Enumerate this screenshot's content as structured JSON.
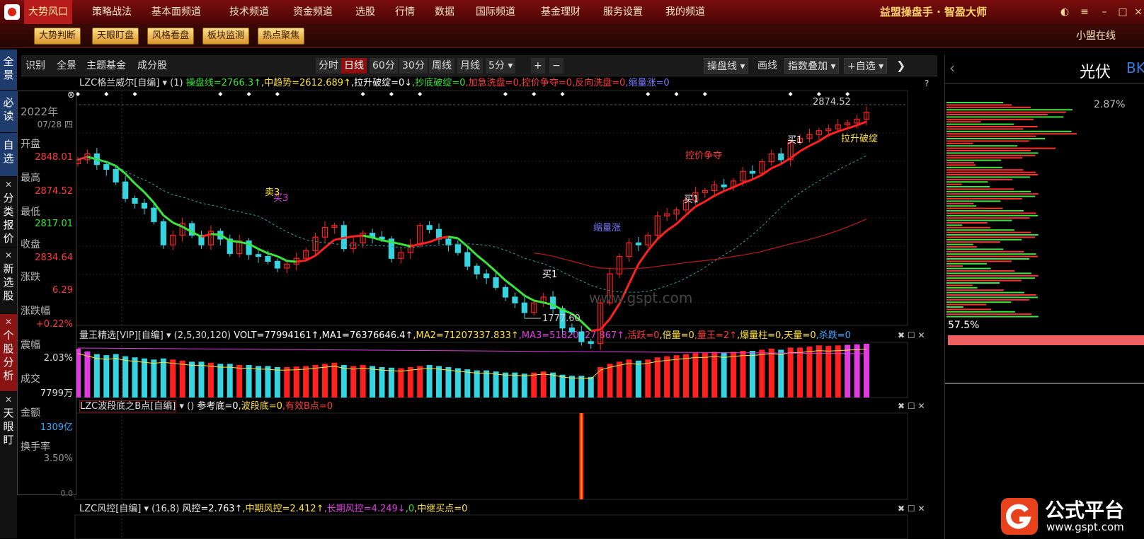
{
  "topmenu": {
    "items": [
      "大势风口",
      "策略战法",
      "基本面频道",
      "技术频道",
      "资金频道",
      "选股",
      "行情",
      "数据",
      "国际频道",
      "基金理财",
      "服务设置",
      "我的频道"
    ],
    "brand": "益盟操盘手 · 智盈大师"
  },
  "subbar": {
    "buttons": [
      "大势判断",
      "天眼盯盘",
      "风格看盘",
      "板块监测",
      "热点聚焦"
    ],
    "online": "小盟在线"
  },
  "lefttabs": [
    "全景",
    "必读",
    "自选",
    "分类报价",
    "新选股",
    "个股分析",
    "天眼盯"
  ],
  "info": {
    "year": "2022年",
    "date": "07/28 四",
    "open_label": "开盘",
    "open": "2848.01",
    "high_label": "最高",
    "high": "2874.52",
    "low_label": "最低",
    "low": "2817.01",
    "close_label": "收盘",
    "close": "2834.64",
    "change_label": "涨跌",
    "change": "6.29",
    "pct_label": "涨跌幅",
    "pct": "+0.22%",
    "amp_label": "震幅",
    "amp": "2.03%",
    "vol_label": "成交",
    "vol": "7799万",
    "amt_label": "金额",
    "amt": "1309亿",
    "turn_label": "换手率",
    "turn": "3.50%",
    "zero": "0.0"
  },
  "toolbar": {
    "left": [
      "识别",
      "全景",
      "主题基金",
      "成分股"
    ],
    "periods": [
      "分时",
      "日线",
      "60分",
      "30分",
      "周线",
      "月线",
      "5分"
    ],
    "active_period": "日线",
    "plus": "+",
    "minus": "−",
    "right": [
      "操盘线",
      "画线",
      "指数叠加",
      "+自选"
    ]
  },
  "main_panel": {
    "name": "LZC格兰威尔[自编]",
    "param": "(1)",
    "items": [
      {
        "t": "操盘线=2766.3↑",
        "c": "#35e635"
      },
      {
        "t": "中趋势=2612.689↑",
        "c": "#ffe23a"
      },
      {
        "t": "拉升破绽=0↓",
        "c": "#ffffff"
      },
      {
        "t": "抄底破绽=0",
        "c": "#35e635"
      },
      {
        "t": "加急洗盘=0",
        "c": "#ff3b3b"
      },
      {
        "t": "控价争夺=0",
        "c": "#ff3b3b"
      },
      {
        "t": "反向洗盘=0",
        "c": "#ff3b3b"
      },
      {
        "t": "缩量涨=0",
        "c": "#7b7bff"
      }
    ],
    "high_label": "2874.52",
    "low_label": "1777.60",
    "right_pct": "2.87%",
    "annotations": [
      {
        "t": "买3",
        "c": "#d63bd6"
      },
      {
        "t": "卖3",
        "c": "#ffe23a"
      },
      {
        "t": "买1",
        "c": "#ffffff"
      },
      {
        "t": "控价争夺",
        "c": "#ff3b3b"
      },
      {
        "t": "买1",
        "c": "#ffffff"
      },
      {
        "t": "买1",
        "c": "#ffffff"
      },
      {
        "t": "拉升破绽",
        "c": "#ffe23a"
      },
      {
        "t": "缩量涨",
        "c": "#7b7bff"
      }
    ],
    "watermark": "www.gspt.com"
  },
  "vol_panel": {
    "name": "量王精选[VIP][自编]",
    "param": "(2,5,30,120)",
    "items": [
      {
        "t": "VOLT=77994161↑",
        "c": "#ffffff"
      },
      {
        "t": "MA1=76376646.4↑",
        "c": "#ffffff"
      },
      {
        "t": "MA2=71207337.833↑",
        "c": "#ffe23a"
      },
      {
        "t": "MA3=51820627.867↑",
        "c": "#e03be0"
      },
      {
        "t": "活跃=0",
        "c": "#ff3b3b"
      },
      {
        "t": "倍量=0",
        "c": "#ffe23a"
      },
      {
        "t": "量王=2↑",
        "c": "#ff3b3b"
      },
      {
        "t": "爆量柱=0",
        "c": "#ffe23a"
      },
      {
        "t": "天量=0",
        "c": "#ffe23a"
      },
      {
        "t": "杀跌=0",
        "c": "#3ba8ff"
      }
    ]
  },
  "wave_panel": {
    "name": "LZC波段底之B点[自编]",
    "param": "()",
    "items": [
      {
        "t": "参考底=0",
        "c": "#ffffff"
      },
      {
        "t": "波段底=0",
        "c": "#ffe23a"
      },
      {
        "t": "有效B点=0",
        "c": "#ff3b3b"
      }
    ]
  },
  "risk_panel": {
    "name": "LZC风控[自编]",
    "param": "(16,8)",
    "items": [
      {
        "t": "风控=2.763↑",
        "c": "#ffffff"
      },
      {
        "t": "中期风控=2.412↑",
        "c": "#ffe23a"
      },
      {
        "t": "长期风控=4.249↓",
        "c": "#e03be0"
      },
      {
        "t": "0",
        "c": "#35e635"
      },
      {
        "t": "中继买点=0",
        "c": "#ffe23a"
      }
    ]
  },
  "right_panel": {
    "title": "光伏",
    "code": "BK",
    "pct_top": "2.87%",
    "pct_bottom": "57.5%"
  },
  "brand_watermark": {
    "name": "公式平台",
    "url": "www.gspt.com"
  },
  "colors": {
    "up": "#ff2020",
    "down": "#36d4e0",
    "ma_green": "#3ae63a",
    "ma_red": "#ff2020"
  },
  "chart_data": {
    "type": "candlestick",
    "ylim": [
      1777.6,
      2874.52
    ],
    "closes": [
      2590,
      2620,
      2565,
      2540,
      2475,
      2390,
      2365,
      2340,
      2270,
      2150,
      2200,
      2260,
      2200,
      2150,
      2220,
      2180,
      2105,
      2170,
      2100,
      2090,
      2065,
      2030,
      2050,
      2080,
      2120,
      2190,
      2240,
      2250,
      2130,
      2160,
      2210,
      2190,
      2180,
      2080,
      2110,
      2150,
      2250,
      2230,
      2180,
      2150,
      2110,
      2040,
      2000,
      1980,
      1930,
      1880,
      1850,
      1800,
      1850,
      1880,
      1820,
      1720,
      1700,
      1650,
      1640,
      1850,
      2000,
      2090,
      2160,
      2150,
      2200,
      2300,
      2310,
      2330,
      2380,
      2420,
      2430,
      2460,
      2450,
      2480,
      2530,
      2520,
      2580,
      2620,
      2590,
      2680,
      2700,
      2720,
      2740,
      2750,
      2770,
      2780,
      2800,
      2835
    ],
    "volumes": [
      90,
      85,
      80,
      78,
      80,
      76,
      74,
      72,
      70,
      72,
      70,
      68,
      66,
      66,
      64,
      62,
      62,
      60,
      60,
      58,
      58,
      56,
      56,
      57,
      58,
      60,
      62,
      64,
      60,
      58,
      60,
      58,
      56,
      55,
      54,
      56,
      58,
      60,
      58,
      56,
      54,
      52,
      50,
      50,
      48,
      46,
      46,
      44,
      46,
      48,
      46,
      42,
      40,
      40,
      38,
      56,
      62,
      66,
      70,
      68,
      70,
      74,
      76,
      78,
      80,
      82,
      82,
      84,
      82,
      84,
      86,
      86,
      88,
      90,
      88,
      92,
      92,
      94,
      96,
      95,
      96,
      97,
      98,
      99
    ]
  }
}
